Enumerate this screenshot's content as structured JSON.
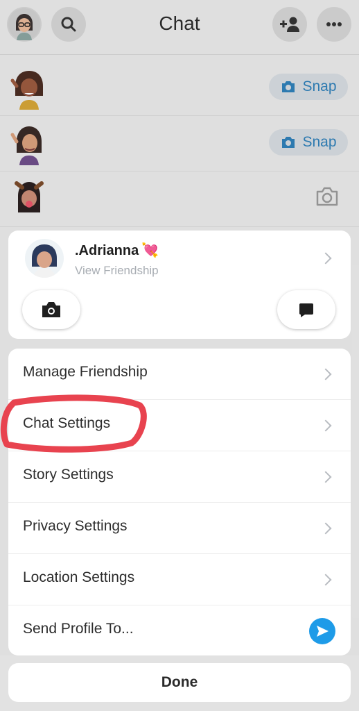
{
  "header": {
    "title": "Chat"
  },
  "chat_list": [
    {
      "action_label": "Snap",
      "action": "snap"
    },
    {
      "action_label": "Snap",
      "action": "snap"
    },
    {
      "action_label": "",
      "action": "camera"
    }
  ],
  "profile": {
    "name": ".Adrianna",
    "subtitle": "View Friendship",
    "heart_glyph": "💘"
  },
  "menu": {
    "items": [
      {
        "label": "Manage Friendship",
        "trailing": "chevron"
      },
      {
        "label": "Chat Settings",
        "trailing": "chevron",
        "highlighted": true
      },
      {
        "label": "Story Settings",
        "trailing": "chevron"
      },
      {
        "label": "Privacy Settings",
        "trailing": "chevron"
      },
      {
        "label": "Location Settings",
        "trailing": "chevron"
      },
      {
        "label": "Send Profile To...",
        "trailing": "send"
      }
    ]
  },
  "footer": {
    "done_label": "Done"
  },
  "colors": {
    "snap_blue": "#2f7fb8",
    "send_blue": "#1e9be8",
    "highlight_red": "#e8434f",
    "heart_pink": "#e0457b"
  }
}
